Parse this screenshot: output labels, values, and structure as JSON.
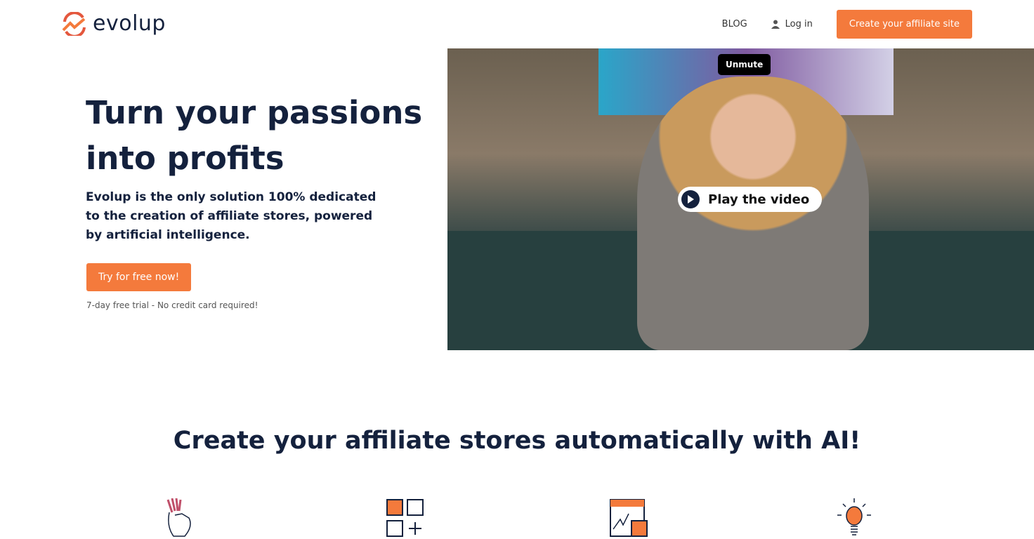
{
  "header": {
    "logo_text": "evolup",
    "nav": {
      "blog": "BLOG",
      "login": "Log in",
      "cta": "Create your affiliate site"
    }
  },
  "hero": {
    "title": "Turn your passions into profits",
    "description": "Evolup is the only solution 100% dedicated to the creation of affiliate stores, powered by artificial intelligence.",
    "cta": "Try for free now!",
    "note": "7-day free trial - No credit card required!"
  },
  "video": {
    "unmute": "Unmute",
    "play": "Play the video"
  },
  "features": {
    "title": "Create your affiliate stores automatically with AI!",
    "icons": [
      "hand-gesture-icon",
      "grid-add-icon",
      "store-chart-icon",
      "lightbulb-icon"
    ]
  },
  "colors": {
    "accent": "#f47a3c",
    "navy": "#14213d"
  }
}
